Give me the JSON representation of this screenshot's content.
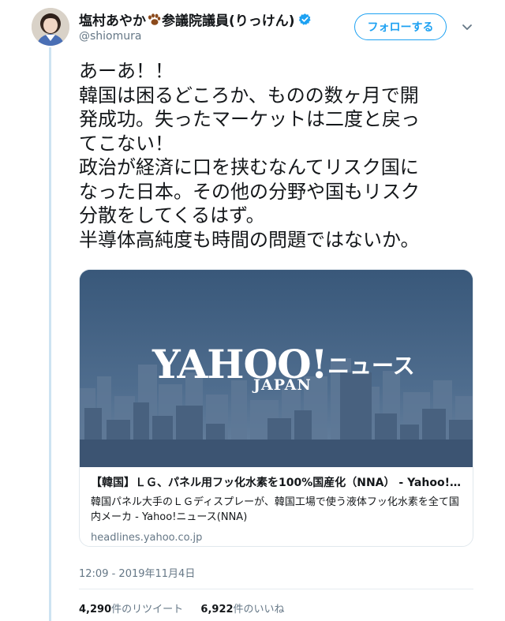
{
  "user": {
    "display_name_prefix": "塩村あやか",
    "display_name_suffix": "参議院議員(りっけん)",
    "handle": "@shiomura"
  },
  "actions": {
    "follow_label": "フォローする"
  },
  "tweet": {
    "lines": [
      "あーあ！！",
      "韓国は困るどころか、ものの数ヶ月で開",
      "発成功。失ったマーケットは二度と戻っ",
      "てこない！",
      "政治が経済に口を挟むなんてリスク国に",
      "なった日本。その他の分野や国もリスク",
      "分散をしてくるはず。",
      "半導体高純度も時間の問題ではないか。"
    ],
    "timestamp": "12:09 - 2019年11月4日"
  },
  "card": {
    "logo_text": "YAHOO!",
    "logo_sub": "JAPAN",
    "logo_news": "ニュース",
    "title": "【韓国】ＬＧ、パネル用フッ化水素を100%国産化（NNA） - Yahoo!ニ…",
    "description": "韓国パネル大手のＬＧディスプレーが、韓国工場で使う液体フッ化水素を全て国内メーカ - Yahoo!ニュース(NNA)",
    "domain": "headlines.yahoo.co.jp"
  },
  "stats": {
    "retweets_count": "4,290",
    "retweets_label": "件のリツイート",
    "likes_count": "6,922",
    "likes_label": "件のいいね"
  },
  "colors": {
    "accent": "#1da1f2",
    "muted": "#657786",
    "text": "#14171a",
    "thread_line": "#cde3f2"
  },
  "icons": {
    "verified": "verified-badge-icon",
    "paw": "paw-icon",
    "caret": "chevron-down-icon"
  }
}
